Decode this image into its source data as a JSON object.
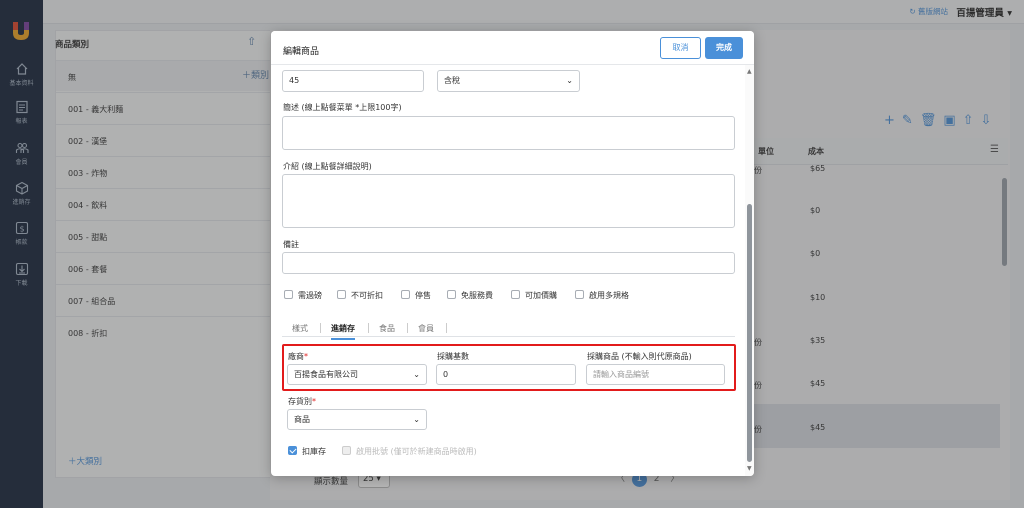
{
  "sidebar": {
    "items": [
      {
        "label": "基本資料",
        "icon": "home-icon"
      },
      {
        "label": "報表",
        "icon": "report-icon"
      },
      {
        "label": "會員",
        "icon": "members-icon"
      },
      {
        "label": "進銷存",
        "icon": "inventory-box-icon"
      },
      {
        "label": "帳款",
        "icon": "dollar-icon"
      },
      {
        "label": "下載",
        "icon": "download-icon"
      }
    ]
  },
  "topbar": {
    "backend_link": "↻ 舊版網站",
    "user": "百揚管理員 ▾"
  },
  "category_panel": {
    "title": "商品類別",
    "add_inline": "＋類別",
    "rows": [
      "無",
      "001 - 義大利麵",
      "002 - 漢堡",
      "003 - 炸物",
      "004 - 飲料",
      "005 - 甜點",
      "006 - 套餐",
      "007 - 組合品",
      "008 - 折扣"
    ],
    "add_big": "＋大類別"
  },
  "product_table": {
    "col_unit": "單位",
    "col_cost": "成本",
    "units": [
      "份",
      "份",
      "份",
      "份"
    ],
    "costs": [
      "$65",
      "$0",
      "$0",
      "$10",
      "$35",
      "$45",
      "$45"
    ]
  },
  "pager": {
    "size_label": "顯示數量",
    "size_value": "25",
    "prev": "〈",
    "current": "1",
    "next_page": "2",
    "next": "〉"
  },
  "modal": {
    "title": "編輯商品",
    "cancel": "取消",
    "done": "完成",
    "price_value": "45",
    "tax_value": "含稅",
    "short_desc_label": "簡述 (線上點餐菜單 *上限100字)",
    "intro_label": "介紹 (線上點餐詳細說明)",
    "note_label": "備註",
    "checkboxes": [
      "需過磅",
      "不可折扣",
      "停售",
      "免服務費",
      "可加價購",
      "啟用多規格"
    ],
    "tabs": [
      "樣式",
      "進銷存",
      "食品",
      "會員"
    ],
    "active_tab": 1,
    "vendor_label": "廠商",
    "vendor_value": "百揚食品有限公司",
    "purchase_base_label": "採購基數",
    "purchase_base_value": "0",
    "purchase_item_label": "採購商品 (不輸入則代原商品)",
    "purchase_item_placeholder": "請輸入商品編號",
    "stock_type_label": "存貨別",
    "stock_type_value": "商品",
    "deduct_stock_label": "扣庫存",
    "batch_label": "啟用批號 (僅可於新建商品時啟用)",
    "required_mark": "*"
  },
  "colors": {
    "accent": "#4a90d9",
    "sidebar": "#17253a",
    "highlight": "#e21b1b"
  }
}
